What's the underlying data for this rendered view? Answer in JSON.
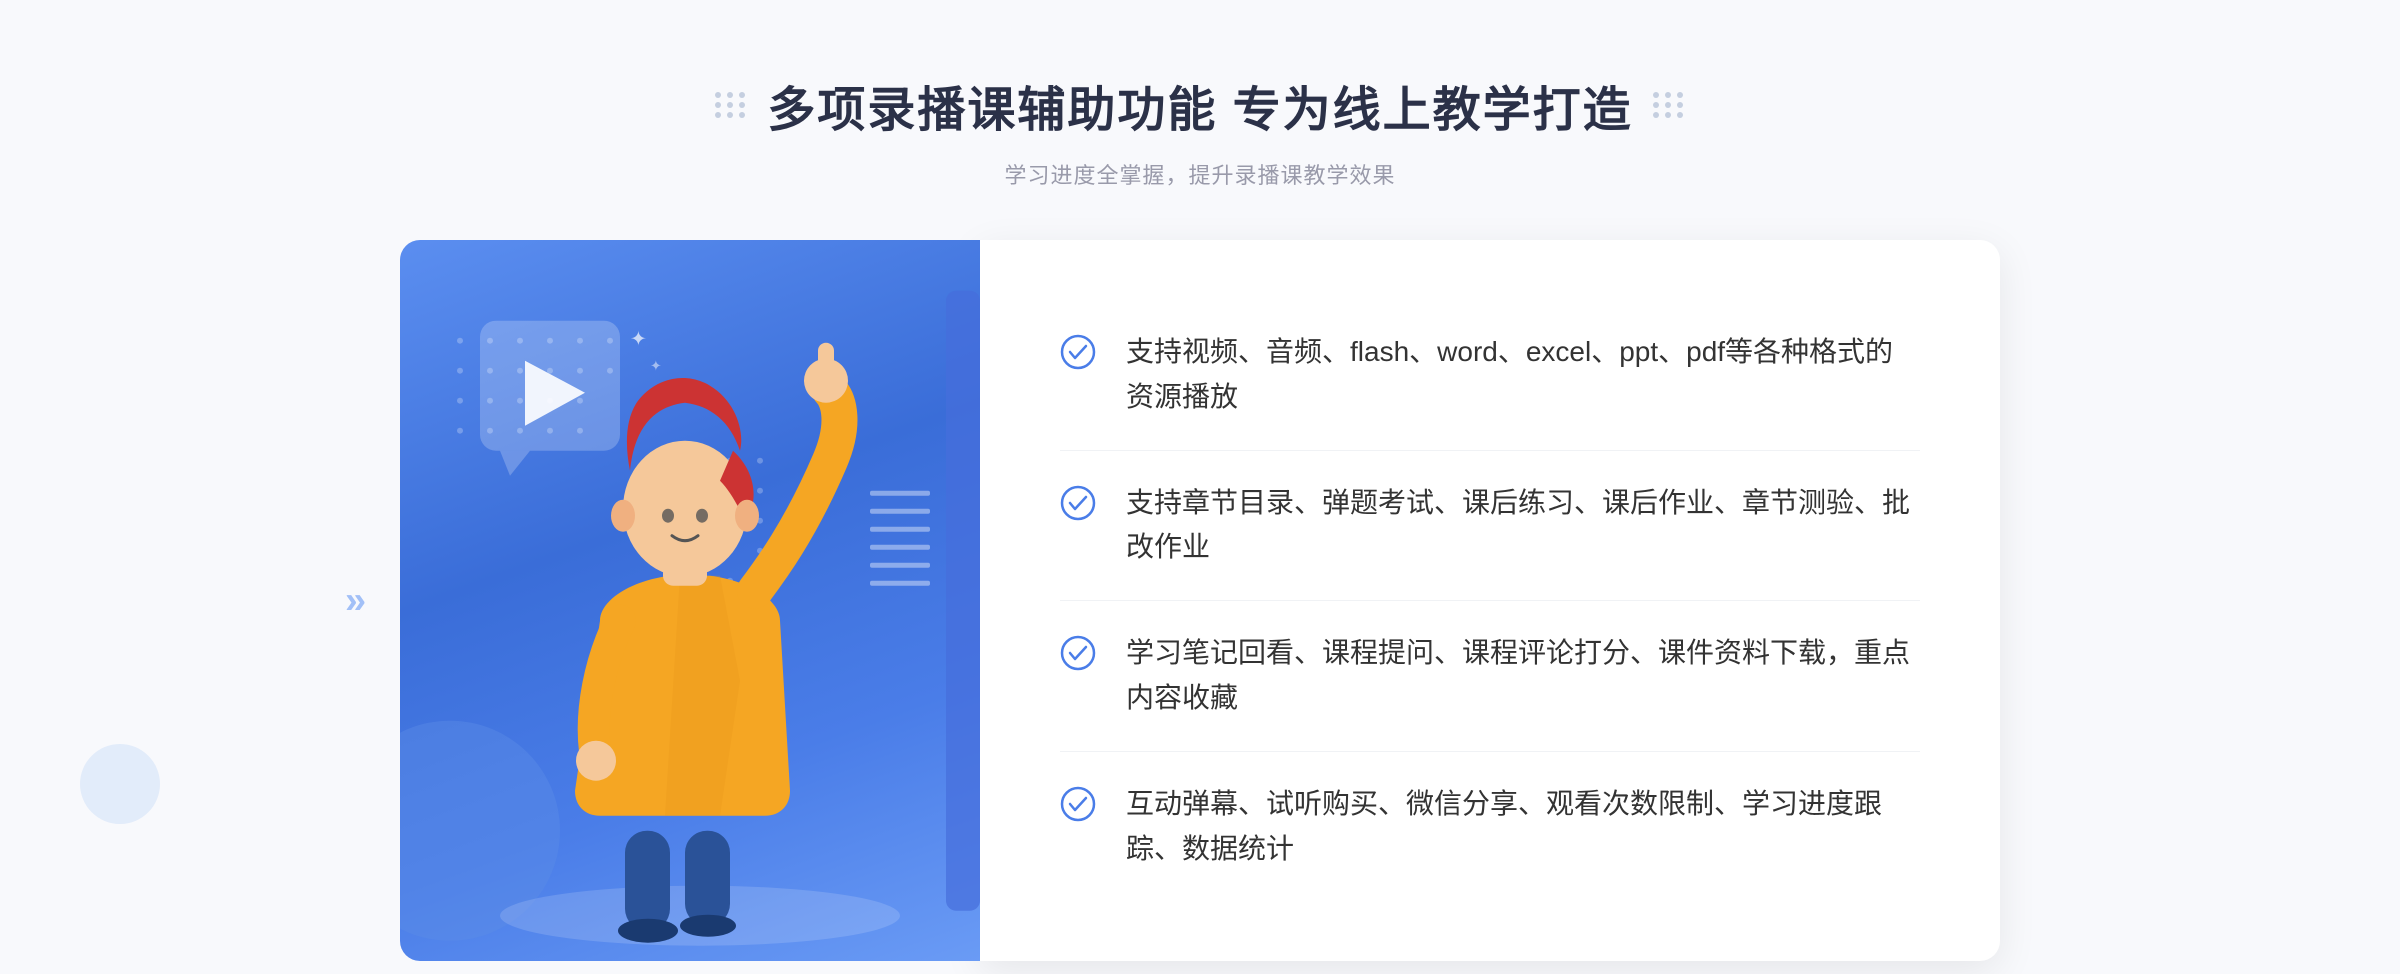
{
  "header": {
    "title": "多项录播课辅助功能 专为线上教学打造",
    "subtitle": "学习进度全掌握，提升录播课教学效果",
    "left_dots_label": "decorative-dots-left",
    "right_dots_label": "decorative-dots-right"
  },
  "features": [
    {
      "id": 1,
      "text": "支持视频、音频、flash、word、excel、ppt、pdf等各种格式的资源播放"
    },
    {
      "id": 2,
      "text": "支持章节目录、弹题考试、课后练习、课后作业、章节测验、批改作业"
    },
    {
      "id": 3,
      "text": "学习笔记回看、课程提问、课程评论打分、课件资料下载，重点内容收藏"
    },
    {
      "id": 4,
      "text": "互动弹幕、试听购买、微信分享、观看次数限制、学习进度跟踪、数据统计"
    }
  ],
  "colors": {
    "primary_blue": "#4a7de8",
    "light_blue": "#6a9bf5",
    "text_dark": "#2b3148",
    "text_gray": "#999aaa",
    "text_body": "#333333",
    "bg_light": "#f8f9fc",
    "check_color": "#4a7de8"
  },
  "illustration": {
    "left_arrows": "«",
    "play_button_label": "play-icon"
  }
}
